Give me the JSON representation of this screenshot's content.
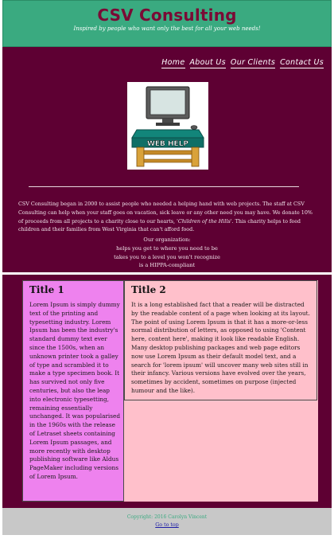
{
  "site": {
    "title": "CSV Consulting",
    "tagline": "Inspired by people who want only the best for all your web needs!"
  },
  "nav": {
    "items": [
      {
        "label": "Home"
      },
      {
        "label": "About Us"
      },
      {
        "label": "Our Clients"
      },
      {
        "label": "Contact Us"
      }
    ]
  },
  "logo": {
    "sign_text": "WEB HELP"
  },
  "about": {
    "paragraph_before": "CSV Consulting began in 2000 to assist people who needed a helping hand with web projects. The staff at CSV Consulting can help when your staff goes on vacation, sick leave or any other need you may have. We donate 10% of proceeds from all projects to a charity close to our hearts, ",
    "charity": "'Children of the Hills'",
    "paragraph_after": ". This charity helps to feed children and their families from West Virginia that can't afford food.",
    "org_heading": "Our organization:",
    "org_lines": [
      "helps you get to where you need to be",
      "takes you to a level you won't recognize",
      "is a HIPPA-compliant"
    ]
  },
  "columns": {
    "col1": {
      "title": "Title 1",
      "text": "Lorem Ipsum is simply dummy text of the printing and typesetting industry. Lorem Ipsum has been the industry's standard dummy text ever since the 1500s, when an unknown printer took a galley of type and scrambled it to make a type specimen book. It has survived not only five centuries, but also the leap into electronic typesetting, remaining essentially unchanged. It was popularised in the 1960s with the release of Letraset sheets containing Lorem Ipsum passages, and more recently with desktop publishing software like Aldus PageMaker including versions of Lorem Ipsum."
    },
    "col2": {
      "title": "Title 2",
      "text": "It is a long established fact that a reader will be distracted by the readable content of a page when looking at its layout. The point of using Lorem Ipsum is that it has a more-or-less normal distribution of letters, as opposed to using 'Content here, content here', making it look like readable English. Many desktop publishing packages and web page editors now use Lorem Ipsum as their default model text, and a search for 'lorem ipsum' will uncover many web sites still in their infancy. Various versions have evolved over the years, sometimes by accident, sometimes on purpose (injected humour and the like)."
    }
  },
  "footer": {
    "copyright": "Copyright: 2016 Carolyn Vincent",
    "to_top": "Go to top"
  },
  "colors": {
    "header_green": "#3aaa80",
    "maroon": "#5e0033",
    "title_maroon": "#7a0a35",
    "violet": "#ee82ee",
    "pink": "#ffc0cb",
    "footer_gray": "#c8c8c8"
  }
}
